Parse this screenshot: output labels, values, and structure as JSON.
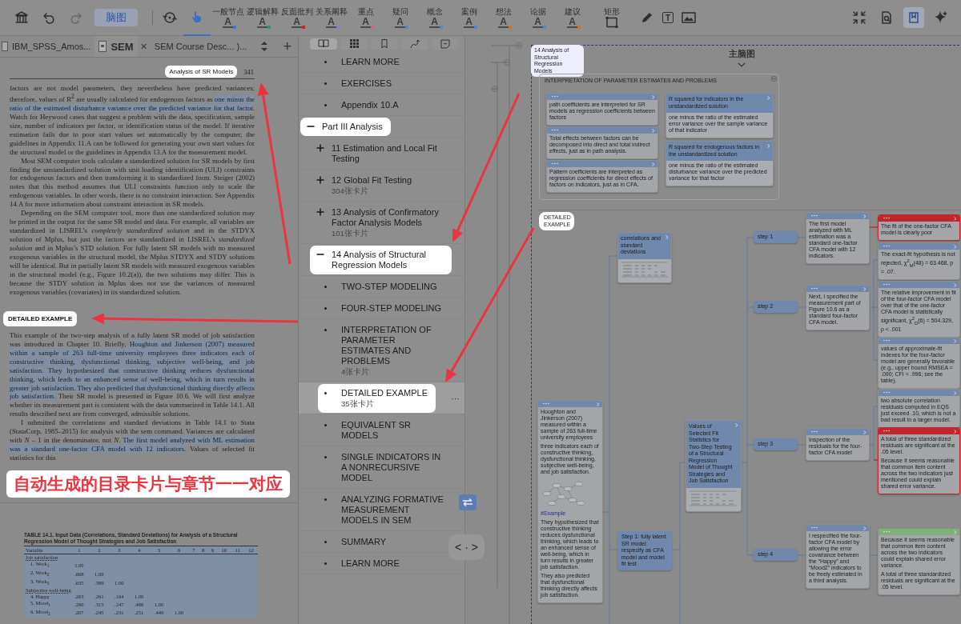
{
  "toolbar": {
    "mode_button": {
      "label": "脑图"
    },
    "hand_tool": {
      "selected": true
    },
    "styles": [
      {
        "label": "一般节点",
        "glyph": "A",
        "color": "#4a76c9"
      },
      {
        "label": "逻辑解释",
        "glyph": "A",
        "color": "#3a9a55"
      },
      {
        "label": "反面批判",
        "glyph": "A",
        "color": "#c8281f"
      },
      {
        "label": "关系阐释",
        "glyph": "A",
        "color": "#8a80c8"
      },
      {
        "label": "重点",
        "glyph": "A",
        "color": "#c8689a"
      },
      {
        "label": "疑问",
        "glyph": "A",
        "color": "#5a84c8"
      },
      {
        "label": "概念",
        "glyph": "A",
        "color": "#5a84c8"
      },
      {
        "label": "案例",
        "glyph": "A",
        "color": "#5a84c8"
      },
      {
        "label": "想法",
        "glyph": "A",
        "color": "#c8762a"
      },
      {
        "label": "论据",
        "glyph": "A",
        "color": "#5a84c8"
      },
      {
        "label": "建议",
        "glyph": "A",
        "color": "#c8762a"
      }
    ],
    "rect_tool": {
      "label": "矩形"
    },
    "text_tool": {
      "glyph": "T"
    },
    "book_view": {
      "selected": true
    }
  },
  "tabs": {
    "items": [
      {
        "label": "IBM_SPSS_Amos...",
        "selected": false
      },
      {
        "label": "SEM",
        "selected": true,
        "close": "×"
      },
      {
        "label": "SEM Course Desc... )...",
        "selected": false
      }
    ],
    "add": "+"
  },
  "pdf": {
    "running_head": {
      "text": "Analysis of SR Models",
      "spotlight": true
    },
    "page_number": "341",
    "paragraphs": [
      {
        "indent": false,
        "parts": [
          {
            "text": "factors are not model parameters, they nevertheless have predicted variances; therefore, values of R$^{2}$ are usually calculated for endogenous factors as ",
            "highlight": false
          },
          {
            "text": "one minus the ratio of the estimated disturbance variance over the predicted variance for that factor",
            "highlight": true
          },
          {
            "text": ". Watch for Heywood cases that suggest a problem with the data, specification, sample size, number of indicators per factor, or identification status of the model. If iterative estimation fails due to poor start values set automatically by the computer, the guidelines in Appendix 11.A can be followed for generating your own start values for the structural model or the guidelines in Appendix 13.A for the measurement model.",
            "highlight": false
          }
        ]
      },
      {
        "indent": true,
        "parts": [
          {
            "text": "Most SEM computer tools calculate a standardized solution for SR models by first finding the unstandardized solution with unit loading identification (ULI) constraints for endogenous factors and then transforming it to standardized form. Steiger (2002) notes that this method assumes that ULI constraints function only to scale the endogenous variables. In other words, there is no constraint interaction. See Appendix 14.A for more information about constraint interaction in SR models.",
            "highlight": false
          }
        ]
      },
      {
        "indent": true,
        "parts": [
          {
            "text": "Depending on the SEM computer tool, more than one standardized solution may be printed in the output for the same SR model and data. For example, all variables are standardized in LISREL’s *completely standardized solution* and in the STDYX solution of Mplus, but just the factors are standardized in LISREL’s *standardized solution* and in Mplus’s STD solution. For fully latent SR models with no measured exogenous variables in the structural model, the Mplus STDYX and STDY solutions will be identical. But in partially latent SR models with measured exogenous variables in the structural model (e.g., Figure 10.2(a)), the two solutions may differ. This is because the STDY solution in Mplus does *not* use the variances of measured exogenous variables (covariates) in its standardized solution.",
            "highlight": false
          }
        ]
      }
    ],
    "heading": {
      "text": "DETAILED EXAMPLE",
      "spotlight": true
    },
    "paragraphs_after": [
      {
        "indent": false,
        "parts": [
          {
            "text": "This example of the two-step analysis of a fully latent SR model of job satisfaction was introduced in Chapter 10. Briefly, ",
            "highlight": false
          },
          {
            "text": "Houghton and Jinkerson (2007) measured within a sample of 263 full-time university employees three indicators each of constructive thinking, dysfunctional thinking, subjective well-being, and job satisfaction. They hypothesized that constructive thinking reduces dysfunctional thinking, which leads to an enhanced sense of well-being, which in turn results in greater job satisfaction. They also predicted that dysfunctional thinking directly affects job satisfaction.",
            "highlight": true
          },
          {
            "text": " Their SR model is presented in Figure 10.6. We will first analyze whether its measurement part is consistent with the data summarized in Table 14.1. All results described next are from converged, admissible solutions.",
            "highlight": false
          }
        ]
      },
      {
        "indent": true,
        "parts": [
          {
            "text": "I submitted the correlations and standard deviations in Table 14.1 to Stata (StataCorp, 1985–2015) for analysis with the sem command. Variances are calculated with *N* – 1 in the denominator, not *N*. ",
            "highlight": false
          },
          {
            "text": "The first model analyzed with ML estimation was a standard one-factor CFA model with 12 indicators.",
            "highlight": true
          },
          {
            "text": " Values of selected fit statistics for this",
            "highlight": false
          }
        ]
      }
    ],
    "table": {
      "caption": "TABLE 14.1. Input Data (Correlations, Standard Deviations) for Analysis of a Structural Regression Model of Thought Strategies and Job Satisfaction",
      "columns": [
        "Variable",
        "1",
        "2",
        "3",
        "4",
        "5",
        "6",
        "7",
        "8",
        "9",
        "10",
        "11",
        "12"
      ],
      "rows": [
        {
          "kind": "group",
          "label": "Job satisfaction"
        },
        {
          "kind": "row",
          "label": "1. Work$_{1}$",
          "cells": [
            "1.00"
          ]
        },
        {
          "kind": "row",
          "label": "2. Work$_{2}$",
          "cells": [
            ".668",
            "1.00"
          ]
        },
        {
          "kind": "row",
          "label": "3. Work$_{3}$",
          "cells": [
            ".635",
            ".599",
            "1.00"
          ]
        },
        {
          "kind": "group",
          "label": "Subjective well-being"
        },
        {
          "kind": "row",
          "label": "4. Happy",
          "cells": [
            ".263",
            ".261",
            ".164",
            "1.00"
          ]
        },
        {
          "kind": "row",
          "label": "5. Mood$_{1}$",
          "cells": [
            ".290",
            ".315",
            ".247",
            ".486",
            "1.00"
          ]
        },
        {
          "kind": "row",
          "label": "6. Mood$_{2}$",
          "cells": [
            ".207",
            ".245",
            ".231",
            ".251",
            ".449",
            "1.00"
          ]
        }
      ]
    }
  },
  "toc": {
    "view_tabs": [
      {
        "kind": "book",
        "selected": true
      },
      {
        "kind": "grid",
        "selected": false
      },
      {
        "kind": "bookmark",
        "selected": false
      },
      {
        "kind": "path",
        "selected": false
      },
      {
        "kind": "note",
        "selected": false
      }
    ],
    "items": [
      {
        "kind": "leaf",
        "label": "LEARN MORE",
        "selected": false,
        "spotlight": false
      },
      {
        "kind": "leaf",
        "label": "EXERCISES",
        "selected": false,
        "spotlight": false
      },
      {
        "kind": "leaf",
        "label": "Appendix 10.A",
        "selected": false,
        "spotlight": false
      },
      {
        "kind": "branch",
        "label": "Part III Analysis",
        "expanded": true,
        "selected": false,
        "spotlight": true,
        "children": [
          {
            "kind": "branch",
            "label": "11 Estimation and Local Fit Testing",
            "expanded": false,
            "selected": false,
            "spotlight": false
          },
          {
            "kind": "branch",
            "label": "12 Global Fit Testing",
            "count": "304张卡片",
            "expanded": false,
            "selected": false,
            "spotlight": false
          },
          {
            "kind": "branch",
            "label": "13 Analysis of Confirmatory Factor Analysis Models",
            "count": "101张卡片",
            "expanded": false,
            "selected": false,
            "spotlight": false
          },
          {
            "kind": "branch",
            "label": "14 Analysis of Structural Regression Models",
            "expanded": true,
            "selected": false,
            "spotlight": true,
            "children": [
              {
                "kind": "leaf",
                "label": "TWO-STEP MODELING",
                "selected": false,
                "spotlight": false
              },
              {
                "kind": "leaf",
                "label": "FOUR-STEP MODELING",
                "selected": false,
                "spotlight": false
              },
              {
                "kind": "leaf",
                "label": "INTERPRETATION OF PARAMETER ESTIMATES AND PROBLEMS",
                "count": "4张卡片",
                "selected": false,
                "spotlight": false
              },
              {
                "kind": "leaf",
                "label": "DETAILED EXAMPLE",
                "count": "35张卡片",
                "more": "···",
                "selected": true,
                "spotlight": true
              },
              {
                "kind": "leaf",
                "label": "EQUIVALENT SR MODELS",
                "selected": false,
                "spotlight": false
              },
              {
                "kind": "leaf",
                "label": "SINGLE INDICATORS IN A NONRECURSIVE MODEL",
                "selected": false,
                "spotlight": false
              },
              {
                "kind": "leaf",
                "label": "ANALYZING FORMATIVE MEASUREMENT MODELS IN SEM",
                "selected": false,
                "spotlight": false
              },
              {
                "kind": "leaf",
                "label": "SUMMARY",
                "selected": false,
                "spotlight": false
              },
              {
                "kind": "leaf",
                "label": "LEARN MORE",
                "selected": false,
                "spotlight": false
              }
            ]
          }
        ]
      }
    ]
  },
  "mindmap": {
    "title": "主脑图",
    "root": {
      "text": "14 Analysis of Structural Regression Models",
      "spotlight": true
    },
    "group": {
      "title": "INTERPRETATION OF PARAMETER ESTIMATES AND PROBLEMS",
      "cards": [
        {
          "kind": "note",
          "blocks": [
            {
              "kind": "text",
              "text": "path coefficients are interpreted for SR models as regression coefficients between factors"
            }
          ]
        },
        {
          "kind": "note",
          "blocks": [
            {
              "kind": "text",
              "text": "Total effects between factors can be decomposed into direct and total indirect effects, just as in path analysis."
            }
          ]
        },
        {
          "kind": "note",
          "blocks": [
            {
              "kind": "text",
              "text": "Pattern coefficients are interpreted as regression coefficients for direct effects of factors on indicators, just as in CFA."
            }
          ]
        },
        {
          "kind": "titled",
          "title": "R squared for indicators in the unstandardized solution",
          "blocks": [
            {
              "kind": "text",
              "text": "one minus the ratio of the estimated error variance over the sample variance of that indicator"
            }
          ]
        },
        {
          "kind": "titled",
          "title": "R squared for endogenous factors in the unstandardized solution",
          "blocks": [
            {
              "kind": "text",
              "text": "one minus the ratio of the estimated disturbance variance over the predicted variance for that factor"
            }
          ]
        }
      ]
    },
    "section": {
      "text": "DETAILED EXAMPLE",
      "spotlight": true
    },
    "nodes": [
      {
        "kind": "titled",
        "title": "correlations and standard deviations",
        "blocks": [
          {
            "kind": "table"
          }
        ]
      },
      {
        "kind": "note",
        "blocks": [
          {
            "kind": "text",
            "text": "Houghton and Jinkerson (2007) measured within a sample of 263 full-time university employees"
          },
          {
            "kind": "text",
            "text": "three indicators each of constructive thinking, dysfunctional thinking, subjective well-being, and job satisfaction."
          },
          {
            "kind": "figure"
          },
          {
            "kind": "tag",
            "text": "#Example"
          },
          {
            "kind": "text",
            "text": "They hypothesized that constructive thinking reduces dysfunctional thinking, which leads to an enhanced sense of well-being, which in turn results in greater job satisfaction."
          },
          {
            "kind": "text",
            "text": "They also predicted that dysfunctional thinking directly affects job satisfaction."
          }
        ]
      },
      {
        "kind": "step",
        "title": "Step 1: fully latent SR model respecify as CFA model and model fit test"
      },
      {
        "kind": "titled",
        "title": "Values of Selected Fit Statistics for Two-Step Testing of a Structural Regression Model of Thought Strategies and Job Satisfaction",
        "blocks": [
          {
            "kind": "table"
          }
        ]
      },
      {
        "kind": "step",
        "title": "step 1"
      },
      {
        "kind": "step",
        "title": "step 2"
      },
      {
        "kind": "step",
        "title": "step 3"
      },
      {
        "kind": "step",
        "title": "step 4"
      },
      {
        "kind": "note",
        "blocks": [
          {
            "kind": "text",
            "text": "The first model analyzed with ML estimation was a standard one-factor CFA model with 12 indicators."
          }
        ]
      },
      {
        "kind": "alert",
        "blocks": [
          {
            "kind": "text",
            "text": "The fit of the one-factor CFA model is clearly poor"
          }
        ]
      },
      {
        "kind": "note",
        "blocks": [
          {
            "kind": "text",
            "text": "Next, I specified the measurement part of Figure 10.6 as a standard four-factor CFA model."
          }
        ]
      },
      {
        "kind": "note",
        "blocks": [
          {
            "kind": "text",
            "text": "The exact-fit hypothesis is not rejected, χ$^{2}$$_{M}$(48) = 63.468, p = .07."
          }
        ]
      },
      {
        "kind": "note",
        "blocks": [
          {
            "kind": "text",
            "text": "The relative improvement in fit of the four-factor CFA model over that of the one-factor CFA model is statistically significant, χ$^{2}$$_{D}$(6) = 504.329, p < .001"
          }
        ]
      },
      {
        "kind": "note",
        "blocks": [
          {
            "kind": "text",
            "text": "values of approximate-fit indexes for the four-factor model are generally favorable (e.g., upper bound RMSEA = .090; CFI = .996; see the table)."
          }
        ]
      },
      {
        "kind": "note",
        "blocks": [
          {
            "kind": "text",
            "text": "Inspection of the residuals for the four-factor CFA model"
          }
        ]
      },
      {
        "kind": "note",
        "blocks": [
          {
            "kind": "text",
            "text": "two absolute correlation residuals computed in EQS just exceed .10, which is not a bad result in a larger model."
          }
        ]
      },
      {
        "kind": "alert",
        "blocks": [
          {
            "kind": "text",
            "text": "A total of three standardized residuals are significant at the .05 level."
          },
          {
            "kind": "text",
            "text": "Because it seems reasonable that common item content across the two indicators just mentioned could explain shared error variance."
          }
        ]
      },
      {
        "kind": "note",
        "blocks": [
          {
            "kind": "text",
            "text": "I respecified the four-factor CFA model by allowing the error covariance between the “Happy” and “Mood2” indicators to be freely estimated in a third analysis."
          }
        ]
      },
      {
        "kind": "ok",
        "blocks": [
          {
            "kind": "text",
            "text": "Because it seems reasonable that common item content across the two indicators could explain shared error variance."
          },
          {
            "kind": "text",
            "text": "A total of three standardized residuals are significant at the .05 level."
          }
        ]
      }
    ]
  },
  "pager": {
    "prev": "<",
    "dot": "·",
    "next": ">"
  },
  "banner": "自动生成的目录卡片与章节一一对应"
}
